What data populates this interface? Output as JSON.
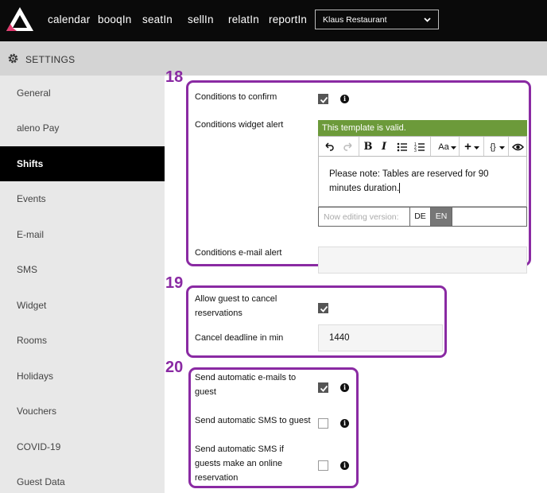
{
  "nav": {
    "links": [
      "calendar",
      "booqIn",
      "seatIn",
      "sellIn",
      "relatIn",
      "reportIn"
    ],
    "restaurant": "Klaus Restaurant"
  },
  "settings": {
    "title": "SETTINGS"
  },
  "sidebar": {
    "items": [
      {
        "label": "General"
      },
      {
        "label": "aleno Pay"
      },
      {
        "label": "Shifts",
        "active": true
      },
      {
        "label": "Events"
      },
      {
        "label": "E-mail"
      },
      {
        "label": "SMS"
      },
      {
        "label": "Widget"
      },
      {
        "label": "Rooms"
      },
      {
        "label": "Holidays"
      },
      {
        "label": "Vouchers"
      },
      {
        "label": "COVID-19"
      },
      {
        "label": "Guest Data"
      }
    ]
  },
  "sections": {
    "s18": {
      "number": "18",
      "conditions_confirm_label": "Conditions to confirm",
      "conditions_confirm_checked": true,
      "widget_alert_label": "Conditions widget alert",
      "valid_message": "This template is valid.",
      "toolbar": {
        "font_size": "Aa",
        "insert": "+",
        "variables": "{}"
      },
      "editor_text": "Please note: Tables are reserved for 90 minutes duration.",
      "version_placeholder": "Now editing version:",
      "versions": [
        "DE",
        "EN"
      ],
      "active_version": "EN",
      "email_alert_label": "Conditions e-mail alert",
      "email_alert_value": ""
    },
    "s19": {
      "number": "19",
      "allow_cancel_label_1": "Allow guest to cancel",
      "allow_cancel_label_2": "reservations",
      "allow_cancel_checked": true,
      "deadline_label": "Cancel deadline in min",
      "deadline_value": "1440"
    },
    "s20": {
      "number": "20",
      "auto_email_label_1": "Send automatic e-mails to",
      "auto_email_label_2": "guest",
      "auto_email_checked": true,
      "auto_sms_label": "Send automatic SMS to guest",
      "auto_sms_checked": false,
      "auto_sms_online_label_1": "Send automatic SMS if",
      "auto_sms_online_label_2": "guests make an online",
      "auto_sms_online_label_3": "reservation",
      "auto_sms_online_checked": false
    }
  },
  "colors": {
    "accent": "#8a2aa3",
    "valid": "#6c9a3a",
    "logo_pink": "#e0376b"
  }
}
